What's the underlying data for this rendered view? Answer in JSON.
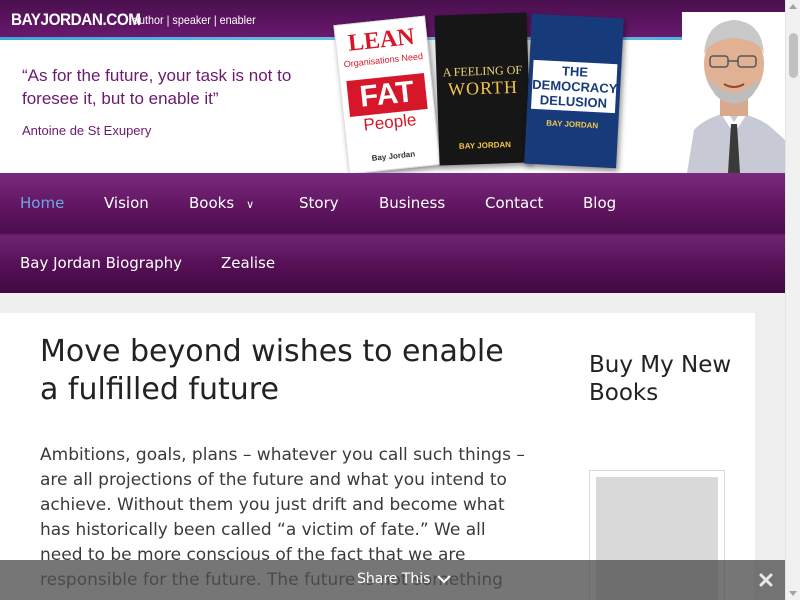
{
  "header": {
    "site_logo": "BAYJORDAN.COM",
    "tagline": "author | speaker | enabler",
    "quote": "“As for the future, your task is not to foresee it, but to enable it”",
    "quote_author": "Antoine de St Exupery",
    "books": [
      {
        "title_top": "LEAN",
        "title_sub": "Organisations Need",
        "title_big": "FAT",
        "title_bottom": "People",
        "author": "Bay Jordan",
        "color": "#d6172a"
      },
      {
        "title_top": "A FEELING OF",
        "title_big": "WORTH",
        "author": "BAY JORDAN",
        "color": "#161616"
      },
      {
        "title_top": "THE DEMOCRACY DELUSION",
        "author": "BAY JORDAN",
        "color": "#173a7a"
      }
    ]
  },
  "nav": {
    "items": [
      {
        "label": "Home",
        "active": true
      },
      {
        "label": "Vision",
        "active": false
      },
      {
        "label": "Books",
        "active": false,
        "has_submenu": true,
        "chevron": "∨"
      },
      {
        "label": "Story",
        "active": false
      },
      {
        "label": "Business",
        "active": false
      },
      {
        "label": "Contact",
        "active": false
      },
      {
        "label": "Blog",
        "active": false
      },
      {
        "label": "Bay Jordan Biography",
        "active": false
      },
      {
        "label": "Zealise",
        "active": false
      }
    ]
  },
  "article": {
    "title": "Move beyond wishes to enable a fulfilled future",
    "body": "Ambitions, goals, plans – whatever you call such things – are all projections of the future and what you intend to achieve. Without them you just drift and become what has historically been called “a victim of fate.” We all need to be more conscious of the fact that we are responsible for the future. The future is not something"
  },
  "sidebar": {
    "widget_title": "Buy My New Books"
  },
  "share_bar": {
    "label": "Share This",
    "chevron_icon": "chevron-down-icon",
    "close_icon": "close-icon"
  },
  "colors": {
    "brand_purple": "#6b1a70",
    "nav_active": "#6aa8e8",
    "accent_blue": "#3aa6d8"
  }
}
